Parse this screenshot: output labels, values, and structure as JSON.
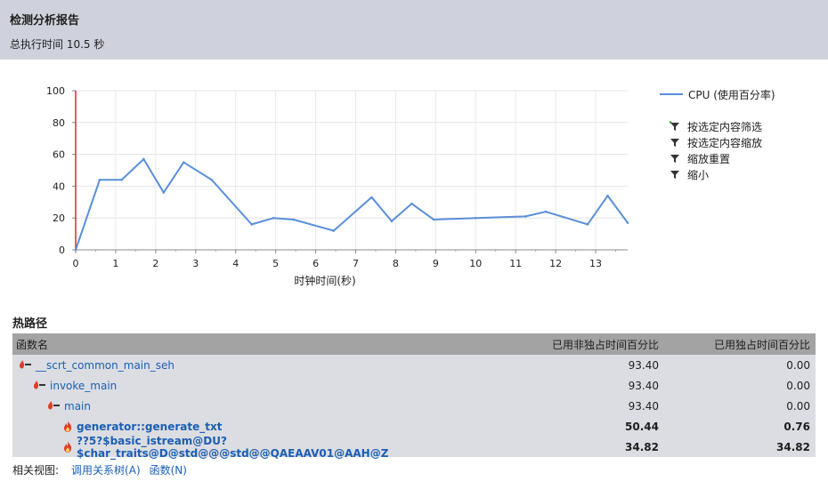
{
  "header": {
    "title": "检测分析报告",
    "subtitle": "总执行时间 10.5 秒"
  },
  "chart_data": {
    "type": "line",
    "xlabel": "时钟时间(秒)",
    "ylabel": "",
    "xlim": [
      0,
      13.8
    ],
    "ylim": [
      0,
      100
    ],
    "x_ticks": [
      "0",
      "1",
      "2",
      "3",
      "4",
      "5",
      "6",
      "7",
      "8",
      "9",
      "10",
      "11",
      "12",
      "13"
    ],
    "y_ticks": [
      "0",
      "20",
      "40",
      "60",
      "80",
      "100"
    ],
    "grid": true,
    "legend_position": "right",
    "series": [
      {
        "name": "CPU (使用百分率)",
        "color": "#5b8fd9",
        "x": [
          0,
          0.6,
          1.15,
          1.7,
          2.2,
          2.7,
          3.4,
          4.4,
          4.95,
          5.45,
          6.45,
          7.4,
          7.9,
          8.4,
          8.95,
          10.0,
          11.25,
          11.75,
          12.8,
          13.3,
          13.8
        ],
        "y": [
          0,
          44,
          44,
          57,
          36,
          55,
          44,
          16,
          20,
          19,
          12,
          33,
          18,
          29,
          19,
          20,
          21,
          24,
          16,
          34,
          17
        ]
      }
    ]
  },
  "filters": [
    {
      "label": "按选定内容筛选",
      "icon": "filter-plus-icon"
    },
    {
      "label": "按选定内容缩放",
      "icon": "filter-icon"
    },
    {
      "label": "缩放重置",
      "icon": "filter-icon"
    },
    {
      "label": "缩小",
      "icon": "filter-icon"
    }
  ],
  "hot_path": {
    "title": "热路径",
    "columns": [
      "函数名",
      "已用非独占时间百分比",
      "已用独占时间百分比"
    ],
    "rows": [
      {
        "name": "__scrt_common_main_seh",
        "inclusive": "93.40",
        "exclusive": "0.00",
        "indent": 0,
        "icon": "hot-path-icon",
        "bold": false
      },
      {
        "name": "invoke_main",
        "inclusive": "93.40",
        "exclusive": "0.00",
        "indent": 1,
        "icon": "hot-path-icon",
        "bold": false
      },
      {
        "name": "main",
        "inclusive": "93.40",
        "exclusive": "0.00",
        "indent": 2,
        "icon": "hot-path-icon",
        "bold": false
      },
      {
        "name": "generator::generate_txt",
        "inclusive": "50.44",
        "exclusive": "0.76",
        "indent": 3,
        "icon": "flame-icon",
        "bold": true
      },
      {
        "name": "??5?$basic_istream@DU?$char_traits@D@std@@@std@@QAEAAV01@AAH@Z",
        "inclusive": "34.82",
        "exclusive": "34.82",
        "indent": 3,
        "icon": "flame-icon",
        "bold": true
      }
    ]
  },
  "footer": {
    "label": "相关视图:",
    "links": [
      "调用关系树(A)",
      "函数(N)"
    ]
  },
  "colors": {
    "header_bg": "#cfd2dc",
    "line": "#5b8fd9",
    "link": "#1a5fb4",
    "table_head": "#a3a3a3",
    "row_bg": "#dcdde2",
    "flame": "#e03b24"
  }
}
